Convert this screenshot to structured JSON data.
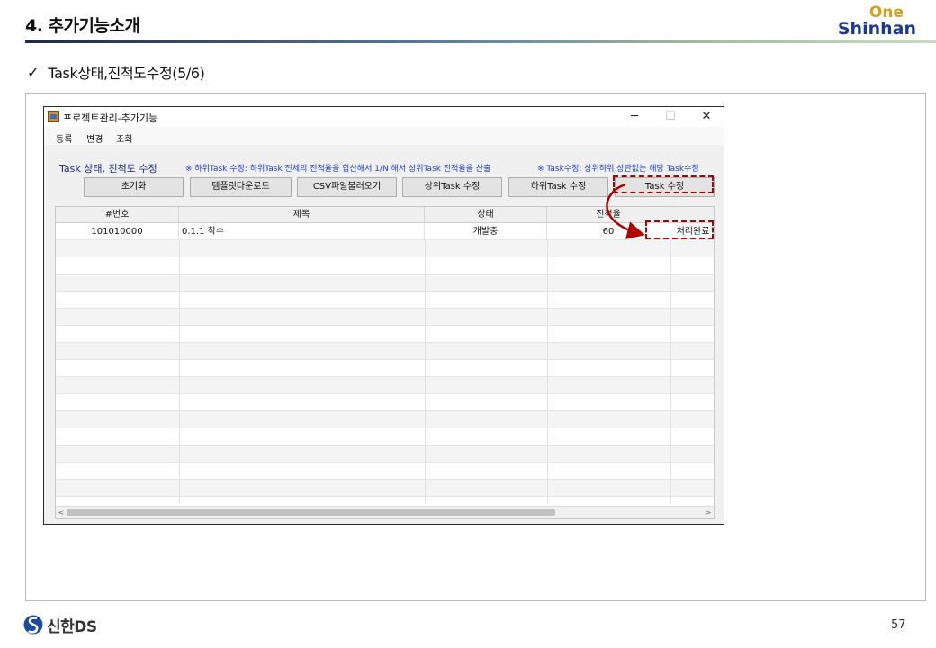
{
  "slide": {
    "title": "4. 추가기능소개",
    "subtitle_check": "✓",
    "subtitle": "Task상태,진척도수정(5/6)",
    "logo_top": "One",
    "logo_bottom": "Shinhan",
    "footer_brand": "신한DS",
    "page_number": "57"
  },
  "window": {
    "title": "프로젝트관리-추가기능",
    "controls": {
      "minimize": "─",
      "maximize": "☐",
      "close": "✕"
    },
    "menu": [
      "등록",
      "변경",
      "조회"
    ],
    "section_title": "Task 상태, 진척도 수정",
    "note_left": "※ 하위Task 수정: 하위Task 전체의 진척율을 합산해서 1/N 해서 상위Task 진척율을 산출",
    "note_right": "※ Task수정: 상위하위 상관없는 해당 Task수정",
    "buttons": [
      "초기화",
      "템플릿다운로드",
      "CSV파일불러오기",
      "상위Task 수정",
      "하위Task 수정",
      "Task 수정"
    ],
    "grid": {
      "columns": [
        "#번호",
        "제목",
        "상태",
        "진척율",
        ""
      ],
      "rows": [
        {
          "number": "101010000",
          "title": "0.1.1 착수",
          "status": "개발중",
          "progress": "60",
          "action": "처리완료"
        }
      ],
      "scroll_left": "<",
      "scroll_right": ">"
    }
  },
  "colors": {
    "highlight": "#b00000",
    "note_blue": "#1e3fd0",
    "logo_blue": "#1c3a8c",
    "logo_gold": "#d8a020"
  }
}
